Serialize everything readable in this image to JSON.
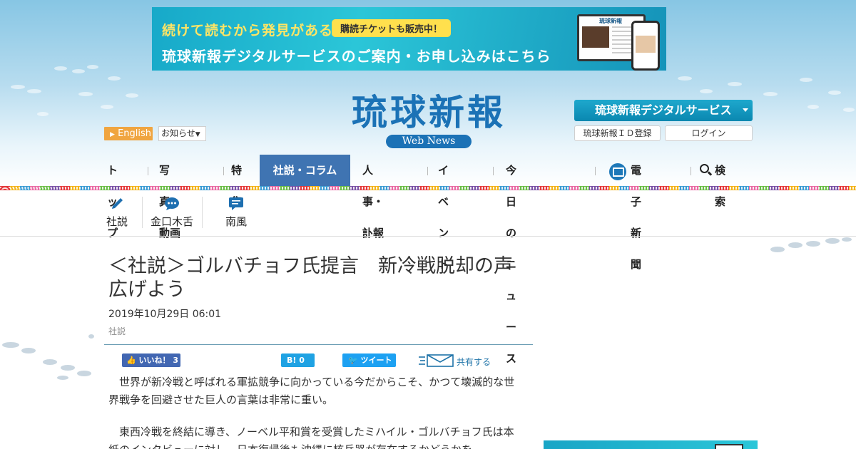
{
  "banner": {
    "line1": "続けて読むから発見がある",
    "badge": "購読チケットも販売中！",
    "line2": "琉球新報デジタルサービスのご案内・お申し込みはこちら",
    "device_title": "琉球新報"
  },
  "header": {
    "lang_button": "English",
    "notice_select": "お知らせ",
    "logo_text": "琉球新報",
    "logo_sub": "Web News",
    "digital_service": "琉球新報デジタルサービス",
    "id_register": "琉球新報ＩＤ登録",
    "login": "ログイン"
  },
  "nav": {
    "top": "トップ",
    "photo": "写真・動画",
    "feature": "特集",
    "editorial": "社説・コラム",
    "personnel": "人事・訃報",
    "event": "イベント",
    "today": "今日のニュース",
    "epaper": "電子新聞",
    "search": "検索"
  },
  "subnav": {
    "shasetsu": "社説",
    "kinkuchi": "金口木舌",
    "haebaru": "南風"
  },
  "article": {
    "title": "＜社説＞ゴルバチョフ氏提言　新冷戦脱却の声広げよう",
    "date": "2019年10月29日 06:01",
    "category": "社説",
    "para1": "世界が新冷戦と呼ばれる軍拡競争に向かっている今だからこそ、かつて壊滅的な世界戦争を回避させた巨人の言葉は非常に重い。",
    "para2": "東西冷戦を終結に導き、ノーベル平和賞を受賞したミハイル・ゴルバチョフ氏は本紙のインタビューに対し、日本復帰後も沖縄に核兵器が存在するかどうかを"
  },
  "share": {
    "like": "いいね！ 3",
    "hatena": "B! 0",
    "tweet": "ツイート",
    "mail_label": "共有する"
  },
  "colors": {
    "brand_blue": "#1b72b6",
    "nav_active": "#3f74b2",
    "english_orange": "#f0a540"
  }
}
